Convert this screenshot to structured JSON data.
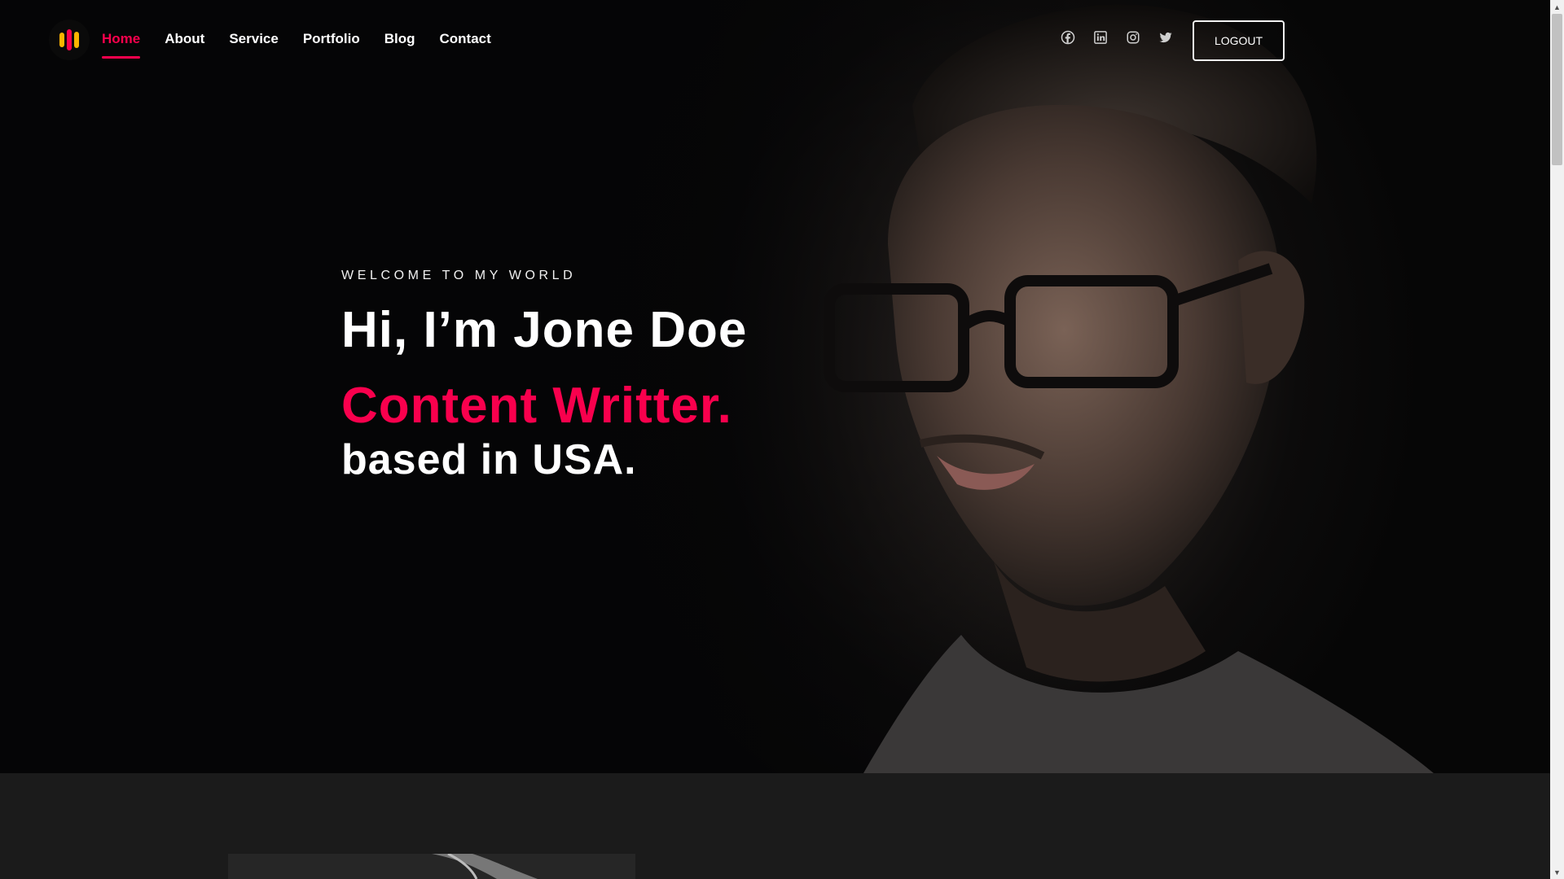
{
  "header": {
    "nav": [
      {
        "label": "Home",
        "active": true
      },
      {
        "label": "About"
      },
      {
        "label": "Service"
      },
      {
        "label": "Portfolio"
      },
      {
        "label": "Blog"
      },
      {
        "label": "Contact"
      }
    ],
    "socials": [
      "facebook-icon",
      "linkedin-icon",
      "instagram-icon",
      "twitter-icon"
    ],
    "logout_label": "LOGOUT"
  },
  "hero": {
    "subtitle": "WELCOME TO MY WORLD",
    "title": "Hi, I’m Jone Doe",
    "role": "Content Writter.",
    "location": "based in USA."
  },
  "colors": {
    "accent": "#f9004d",
    "background": "#1b1b1b",
    "logo_bars": [
      "#f9004d",
      "#fdb400",
      "#f9004d"
    ]
  }
}
